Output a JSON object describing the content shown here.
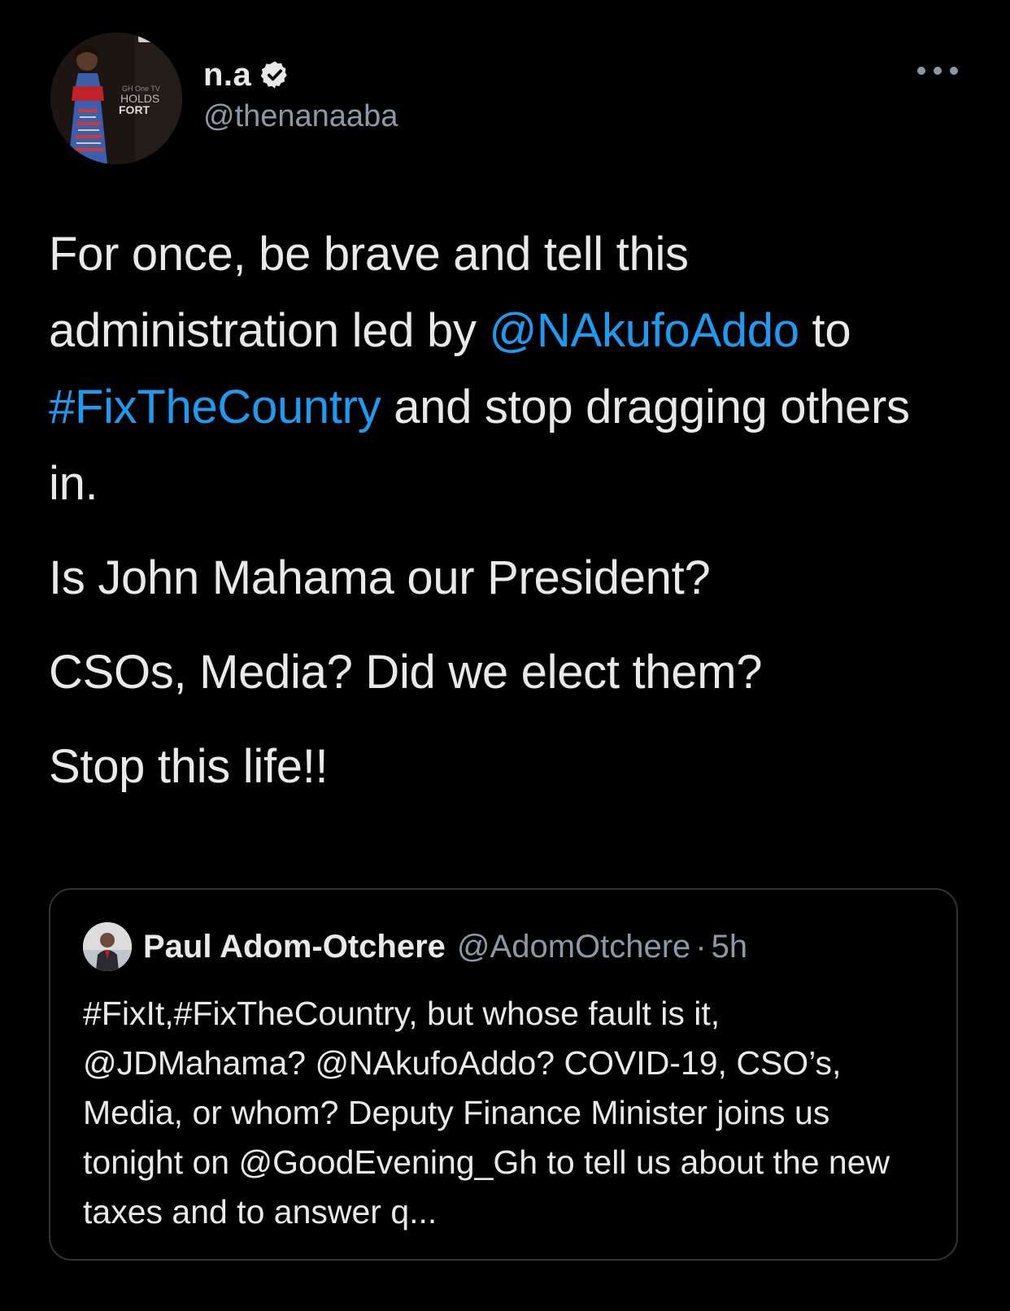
{
  "author": {
    "display_name": "n.a",
    "handle": "@thenanaaba",
    "verified": true,
    "avatar_text": "HOLDS FORT",
    "avatar_brand": "GH One TV"
  },
  "tweet": {
    "para1_part1": "For once, be brave and tell this administration led by ",
    "para1_mention": "@NAkufoAddo",
    "para1_part2": " to ",
    "para1_hashtag": "#FixTheCountry",
    "para1_part3": " and stop dragging others in.",
    "para2": "Is John Mahama our President?",
    "para3": "CSOs, Media? Did we elect them?",
    "para4": "Stop this life!!"
  },
  "quoted": {
    "display_name": "Paul Adom-Otchere",
    "handle": "@AdomOtchere",
    "separator": "·",
    "time": "5h",
    "text": "#FixIt,#FixTheCountry, but whose fault is it, @JDMahama? @NAkufoAddo? COVID-19, CSO’s, Media, or whom? Deputy Finance Minister joins us tonight on @GoodEvening_Gh to tell us about the new taxes and to answer q..."
  },
  "colors": {
    "background": "#000000",
    "text": "#e7e9ea",
    "secondary": "#8b98a5",
    "link": "#1d9bf0",
    "border": "#2f3336"
  },
  "icons": {
    "verified": "verified-badge-icon",
    "more": "more-options-icon"
  }
}
